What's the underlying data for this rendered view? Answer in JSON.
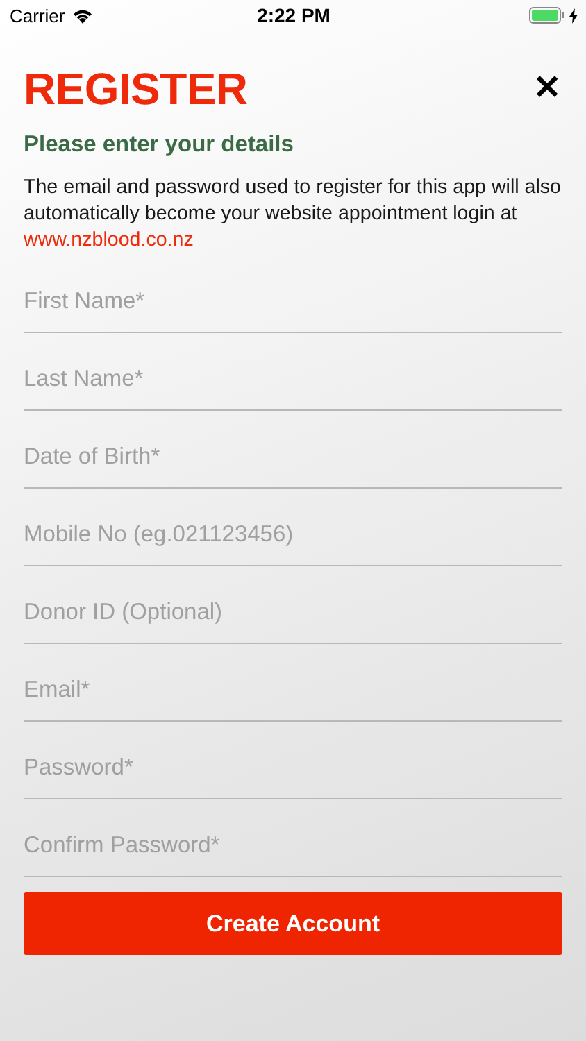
{
  "status_bar": {
    "carrier": "Carrier",
    "time": "2:22 PM"
  },
  "title": "REGISTER",
  "close": "✕",
  "subtitle": "Please enter your details",
  "intro": {
    "text": "The email and password used to register for this app will also automatically become your website appointment login at",
    "link": "www.nzblood.co.nz"
  },
  "fields": [
    {
      "placeholder": "First Name*"
    },
    {
      "placeholder": "Last Name*"
    },
    {
      "placeholder": "Date of Birth*"
    },
    {
      "placeholder": "Mobile No (eg.021123456)"
    },
    {
      "placeholder": "Donor ID (Optional)"
    },
    {
      "placeholder": "Email*"
    },
    {
      "placeholder": "Password*"
    },
    {
      "placeholder": "Confirm Password*"
    }
  ],
  "button": "Create Account"
}
